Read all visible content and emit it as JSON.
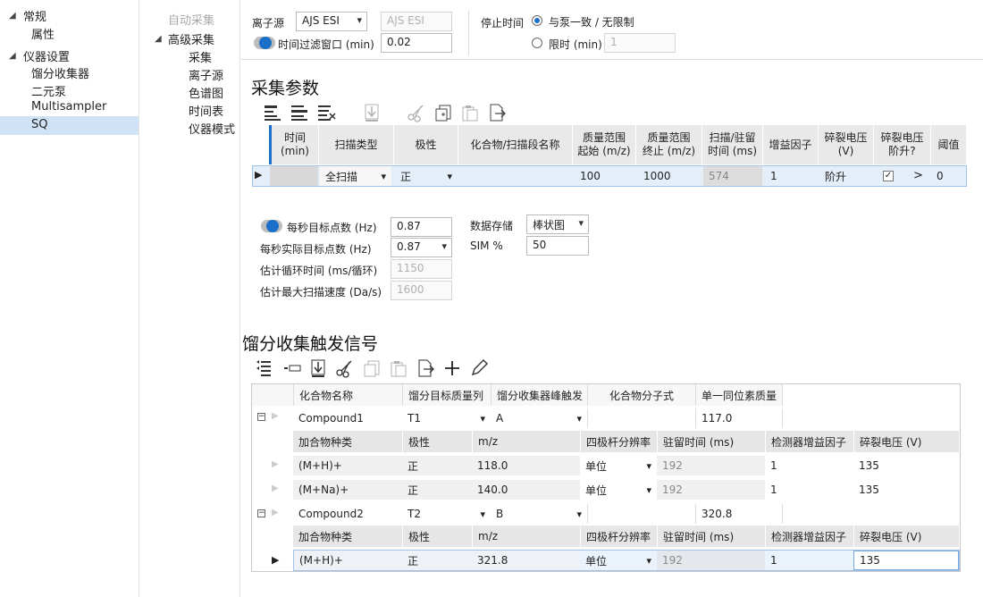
{
  "left_tree": {
    "general": "常规",
    "properties": "属性",
    "instrument_settings": "仪器设置",
    "fraction_collector": "馏分收集器",
    "binary_pump": "二元泵",
    "multisampler": "Multisampler",
    "sq": "SQ"
  },
  "mid_tree": {
    "auto_acq": "自动采集",
    "advanced_acq": "高级采集",
    "acquisition": "采集",
    "ion_source": "离子源",
    "chromatogram": "色谱图",
    "timetable": "时间表",
    "instrument_mode": "仪器模式"
  },
  "top": {
    "ion_source_label": "离子源",
    "ion_source_value": "AJS ESI",
    "ion_source_readonly": "AJS ESI",
    "time_filter_label": "时间过滤窗口 (min)",
    "time_filter_value": "0.02",
    "stop_time_label": "停止时间",
    "stop_opt1": "与泵一致 / 无限制",
    "stop_opt2": "限时 (min)",
    "stop_limit_value": "1"
  },
  "acq_params": {
    "title": "采集参数",
    "headers": [
      "时间\n(min)",
      "扫描类型",
      "极性",
      "化合物/扫描段名称",
      "质量范围\n起始 (m/z)",
      "质量范围\n终止 (m/z)",
      "扫描/驻留\n时间 (ms)",
      "增益因子",
      "碎裂电压\n(V)",
      "碎裂电压\n阶升?",
      "阈值"
    ],
    "row": {
      "scan_type": "全扫描",
      "polarity": "正",
      "mass_start": "100",
      "mass_end": "1000",
      "scan_time": "574",
      "gain": "1",
      "frag_voltage": "阶升",
      "frag_ramp_arrow": ">",
      "threshold": "0"
    }
  },
  "rates": {
    "target_pts_label": "每秒目标点数 (Hz)",
    "target_pts_value": "0.87",
    "actual_pts_label": "每秒实际目标点数 (Hz)",
    "actual_pts_value": "0.87",
    "cycle_time_label": "估计循环时间 (ms/循环)",
    "cycle_time_value": "1150",
    "max_scan_label": "估计最大扫描速度 (Da/s)",
    "max_scan_value": "1600",
    "data_storage_label": "数据存储",
    "data_storage_value": "棒状图",
    "sim_label": "SIM %",
    "sim_value": "50"
  },
  "trigger": {
    "title": "馏分收集触发信号",
    "headers": [
      "化合物名称",
      "馏分目标质量列",
      "馏分收集器峰触发",
      "化合物分子式",
      "单一同位素质量"
    ],
    "sub_headers": [
      "加合物种类",
      "极性",
      "m/z",
      "四极杆分辨率",
      "驻留时间 (ms)",
      "检测器增益因子",
      "碎裂电压 (V)"
    ],
    "compounds": [
      {
        "name": "Compound1",
        "target": "T1",
        "trigger": "A",
        "formula": "",
        "mono_mass": "117.0",
        "adducts": [
          {
            "type": "(M+H)+",
            "polarity": "正",
            "mz": "118.0",
            "resolution": "单位",
            "dwell": "192",
            "gain": "1",
            "frag": "135"
          },
          {
            "type": "(M+Na)+",
            "polarity": "正",
            "mz": "140.0",
            "resolution": "单位",
            "dwell": "192",
            "gain": "1",
            "frag": "135"
          }
        ]
      },
      {
        "name": "Compound2",
        "target": "T2",
        "trigger": "B",
        "formula": "",
        "mono_mass": "320.8",
        "adducts": [
          {
            "type": "(M+H)+",
            "polarity": "正",
            "mz": "321.8",
            "resolution": "单位",
            "dwell": "192",
            "gain": "1",
            "frag": "135"
          }
        ]
      }
    ]
  },
  "colors": {
    "accent": "#1a6fc9",
    "selection": "#cfe2f6",
    "header_bg": "#e9e9e9"
  }
}
